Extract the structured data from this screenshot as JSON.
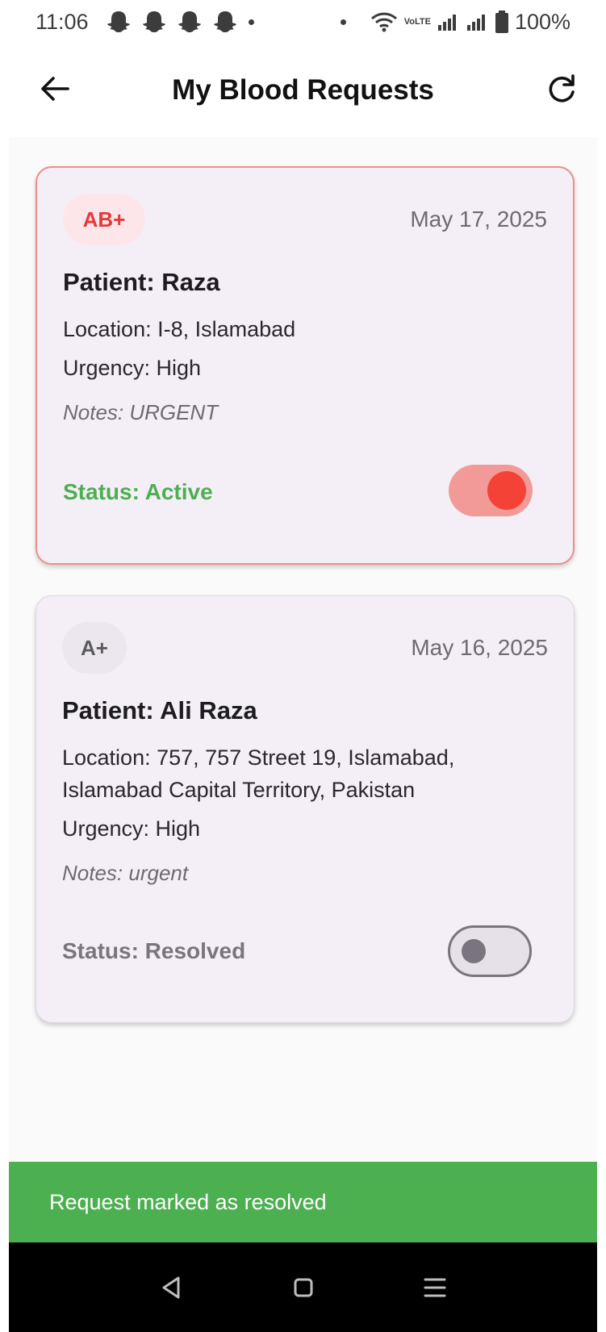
{
  "status_bar": {
    "time": "11:06",
    "battery": "100%",
    "network_label": "VoLTE",
    "icons": [
      "snapchat-ghost-icon",
      "snapchat-ghost-icon",
      "snapchat-ghost-icon",
      "snapchat-ghost-icon",
      "wifi-icon",
      "signal-icon",
      "signal-icon",
      "battery-icon"
    ]
  },
  "app_bar": {
    "title": "My Blood Requests",
    "back_icon": "arrow-back-icon",
    "refresh_icon": "refresh-icon"
  },
  "requests": [
    {
      "blood_type": "AB+",
      "date": "May 17, 2025",
      "patient": "Patient: Raza",
      "location": "Location: I-8, Islamabad",
      "urgency": "Urgency: High",
      "notes": "Notes: URGENT",
      "status": "Status: Active",
      "toggle_on": true
    },
    {
      "blood_type": "A+",
      "date": "May 16, 2025",
      "patient": "Patient: Ali Raza",
      "location": "Location: 757, 757 Street 19, Islamabad, Islamabad Capital Territory, Pakistan",
      "urgency": "Urgency: High",
      "notes": "Notes: urgent",
      "status": "Status: Resolved",
      "toggle_on": false
    }
  ],
  "snackbar": {
    "message": "Request marked as resolved"
  },
  "nav_bar": {
    "icons": [
      "back-triangle-icon",
      "home-square-icon",
      "menu-lines-icon"
    ]
  },
  "colors": {
    "accent_red": "#f44336",
    "active_green": "#4caf50",
    "card_bg": "#f4eff6",
    "snackbar_bg": "#4caf50"
  }
}
